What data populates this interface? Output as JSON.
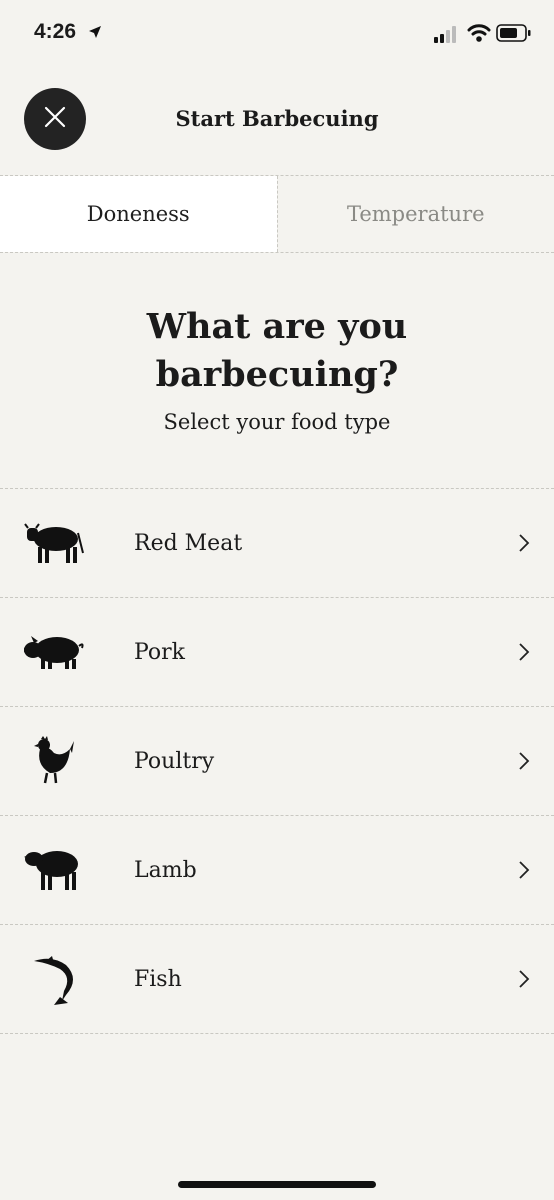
{
  "status_bar": {
    "time": "4:26"
  },
  "header": {
    "title": "Start Barbecuing"
  },
  "tabs": [
    {
      "label": "Doneness",
      "active": true
    },
    {
      "label": "Temperature",
      "active": false
    }
  ],
  "main": {
    "question_line1": "What are you",
    "question_line2": "barbecuing?",
    "subtitle": "Select your food type"
  },
  "food_types": [
    {
      "label": "Red Meat",
      "icon": "cow-icon"
    },
    {
      "label": "Pork",
      "icon": "pig-icon"
    },
    {
      "label": "Poultry",
      "icon": "chicken-icon"
    },
    {
      "label": "Lamb",
      "icon": "sheep-icon"
    },
    {
      "label": "Fish",
      "icon": "fish-icon"
    }
  ],
  "colors": {
    "background": "#f4f3ef",
    "dark": "#232323",
    "active_tab": "#ffffff",
    "inactive_text": "#8a8a85"
  }
}
